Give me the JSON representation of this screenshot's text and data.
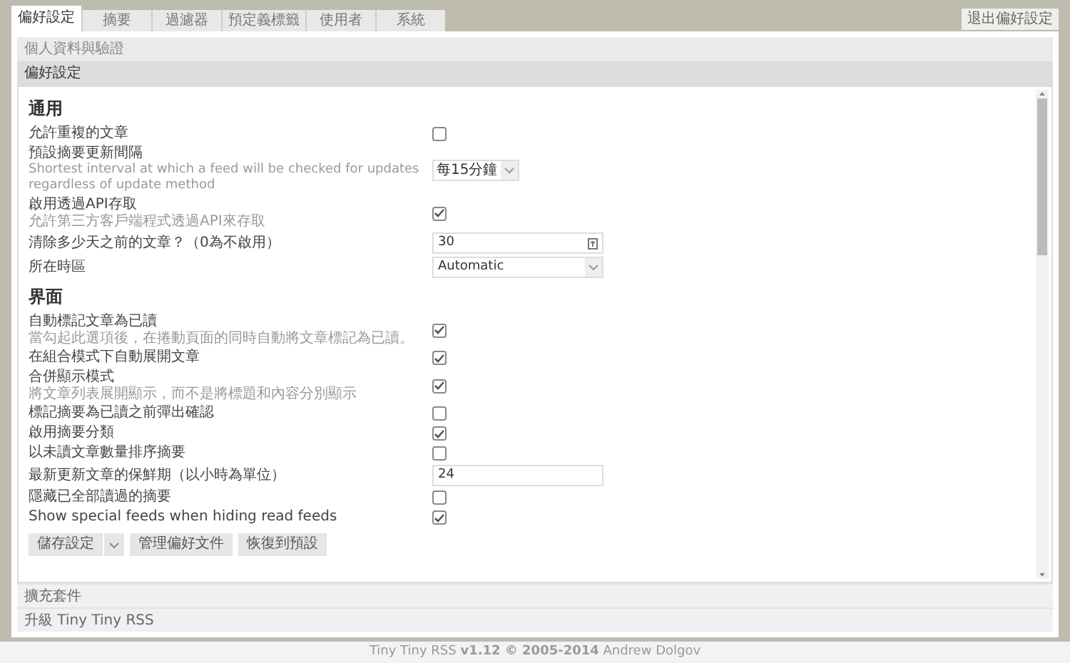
{
  "tabs": [
    {
      "label": "偏好設定",
      "selected": true
    },
    {
      "label": "摘要",
      "selected": false
    },
    {
      "label": "過濾器",
      "selected": false
    },
    {
      "label": "預定義標籤",
      "selected": false
    },
    {
      "label": "使用者",
      "selected": false
    },
    {
      "label": "系統",
      "selected": false
    }
  ],
  "exit_button": "退出偏好設定",
  "accordion_top": [
    {
      "label": "個人資料與驗證",
      "expanded": false
    },
    {
      "label": "偏好設定",
      "expanded": true
    }
  ],
  "sections": [
    {
      "title": "通用",
      "rows": [
        {
          "kind": "checkbox",
          "label": "允許重複的文章",
          "checked": false
        },
        {
          "kind": "select",
          "label": "預設摘要更新間隔",
          "description": "Shortest interval at which a feed will be checked for updates regardless of update method",
          "value": "每15分鐘"
        },
        {
          "kind": "checkbox",
          "label": "啟用透過API存取",
          "description": "允許第三方客戶端程式透過API來存取",
          "checked": true
        },
        {
          "kind": "number",
          "label": "清除多少天之前的文章？（0為不啟用）",
          "value": "30"
        },
        {
          "kind": "wideselect",
          "label": "所在時區",
          "value": "Automatic"
        }
      ]
    },
    {
      "title": "界面",
      "rows": [
        {
          "kind": "checkbox",
          "label": "自動標記文章為已讀",
          "description": "當勾起此選項後，在捲動頁面的同時自動將文章標記為已讀。",
          "checked": true
        },
        {
          "kind": "checkbox",
          "label": "在組合模式下自動展開文章",
          "checked": true
        },
        {
          "kind": "checkbox",
          "label": "合併顯示模式",
          "description": "將文章列表展開顯示，而不是將標題和內容分別顯示",
          "checked": true
        },
        {
          "kind": "checkbox",
          "label": "標記摘要為已讀之前彈出確認",
          "checked": false
        },
        {
          "kind": "checkbox",
          "label": "啟用摘要分類",
          "checked": true
        },
        {
          "kind": "checkbox",
          "label": "以未讀文章數量排序摘要",
          "checked": false
        },
        {
          "kind": "text",
          "label": "最新更新文章的保鮮期（以小時為單位）",
          "value": "24"
        },
        {
          "kind": "checkbox",
          "label": "隱藏已全部讀過的摘要",
          "checked": false
        },
        {
          "kind": "checkbox",
          "label": "Show special feeds when hiding read feeds",
          "checked": true
        }
      ]
    }
  ],
  "buttons": [
    {
      "label": "儲存設定",
      "kind": "split"
    },
    {
      "label": "管理偏好文件",
      "kind": "plain"
    },
    {
      "label": "恢復到預設",
      "kind": "plain"
    }
  ],
  "accordion_bottom": [
    {
      "label": "擴充套件",
      "expanded": false
    },
    {
      "label": "升級 Tiny Tiny RSS",
      "expanded": false
    }
  ],
  "footer": "Tiny Tiny RSS **v1.12 © 2005-2014** Andrew Dolgov"
}
